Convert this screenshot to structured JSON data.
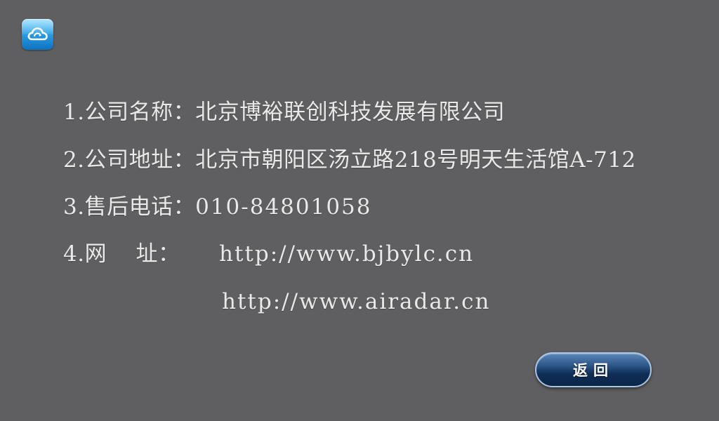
{
  "header": {
    "app_icon": "cloud-sync-icon",
    "icon_color": "#2aa0e4"
  },
  "info": {
    "company_name_label": "1.公司名称：",
    "company_name": "北京博裕联创科技发展有限公司",
    "address_label": "2.公司地址：",
    "address": "北京市朝阳区汤立路218号明天生活馆A-712",
    "phone_label": "3.售后电话：",
    "phone": "010-84801058",
    "website_label": "4.网    址：",
    "website_1": "http://www.bjbylc.cn",
    "website_2": "http://www.airadar.cn"
  },
  "footer": {
    "back_label": "返回",
    "button_color": "#0f2f57"
  },
  "background_color": "#5f5e60"
}
